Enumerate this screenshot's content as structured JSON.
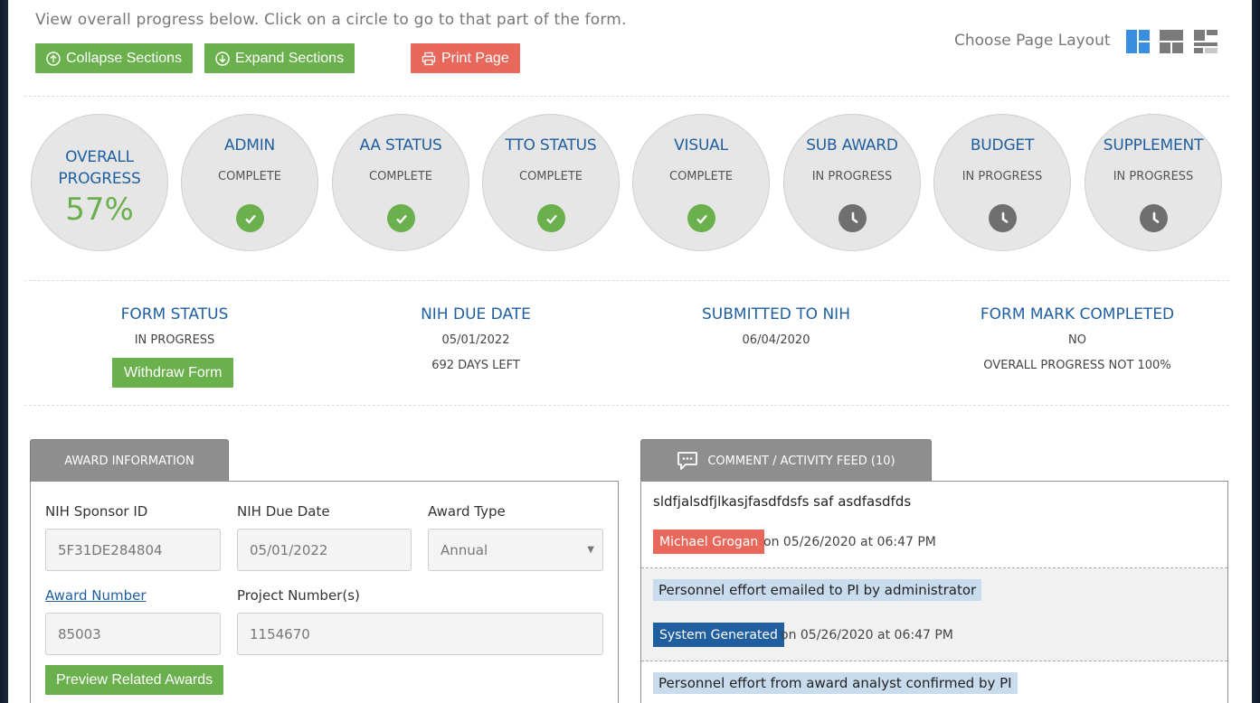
{
  "intro_text": "View overall progress below. Click on a circle to go to that part of the form.",
  "buttons": {
    "collapse": "Collapse Sections",
    "expand": "Expand Sections",
    "print": "Print Page",
    "withdraw": "Withdraw Form",
    "preview": "Preview Related Awards"
  },
  "layout_chooser": {
    "label": "Choose Page Layout",
    "icons": [
      "layout-two-column-icon",
      "layout-grid-icon",
      "layout-mixed-icon"
    ],
    "active": 0
  },
  "progress": {
    "overall_title_1": "OVERALL",
    "overall_title_2": "PROGRESS",
    "overall_percent": "57%",
    "sections": [
      {
        "title": "ADMIN",
        "status": "COMPLETE",
        "icon": "check-icon"
      },
      {
        "title": "AA STATUS",
        "status": "COMPLETE",
        "icon": "check-icon"
      },
      {
        "title": "TTO STATUS",
        "status": "COMPLETE",
        "icon": "check-icon"
      },
      {
        "title": "VISUAL",
        "status": "COMPLETE",
        "icon": "check-icon"
      },
      {
        "title": "SUB AWARD",
        "status": "IN PROGRESS",
        "icon": "clock-icon"
      },
      {
        "title": "BUDGET",
        "status": "IN PROGRESS",
        "icon": "clock-icon"
      },
      {
        "title": "SUPPLEMENT",
        "status": "IN PROGRESS",
        "icon": "clock-icon"
      }
    ]
  },
  "status": {
    "form_status": {
      "title": "FORM STATUS",
      "value": "IN PROGRESS"
    },
    "nih_due_date": {
      "title": "NIH DUE DATE",
      "value": "05/01/2022",
      "sub": "692 DAYS LEFT"
    },
    "submitted": {
      "title": "SUBMITTED TO NIH",
      "value": "06/04/2020"
    },
    "mark_completed": {
      "title": "FORM MARK COMPLETED",
      "value": "NO",
      "sub": "OVERALL PROGRESS NOT 100%"
    }
  },
  "award": {
    "tab_label": "AWARD INFORMATION",
    "sponsor_id_label": "NIH Sponsor ID",
    "sponsor_id_value": "5F31DE284804",
    "due_date_label": "NIH Due Date",
    "due_date_value": "05/01/2022",
    "award_type_label": "Award Type",
    "award_type_value": "Annual",
    "award_number_label": "Award Number",
    "award_number_value": "85003",
    "project_numbers_label": "Project Number(s)",
    "project_numbers_value": "1154670"
  },
  "feed": {
    "tab_label": "COMMENT / ACTIVITY FEED (10)",
    "items": [
      {
        "text": "sldfjalsdfjlkasjfasdfdsfs saf asdfasdfds",
        "author": "Michael Grogan",
        "date": "on 05/26/2020 at 06:47 PM"
      },
      {
        "text": "Personnel effort emailed to PI by administrator",
        "author": "System Generated",
        "date": "on 05/26/2020 at 06:47 PM"
      },
      {
        "text": "Personnel effort from award analyst confirmed by PI"
      }
    ]
  },
  "colors": {
    "accent_green": "#6ab04c",
    "accent_red": "#e8695c",
    "title_blue": "#1f5fa0"
  }
}
